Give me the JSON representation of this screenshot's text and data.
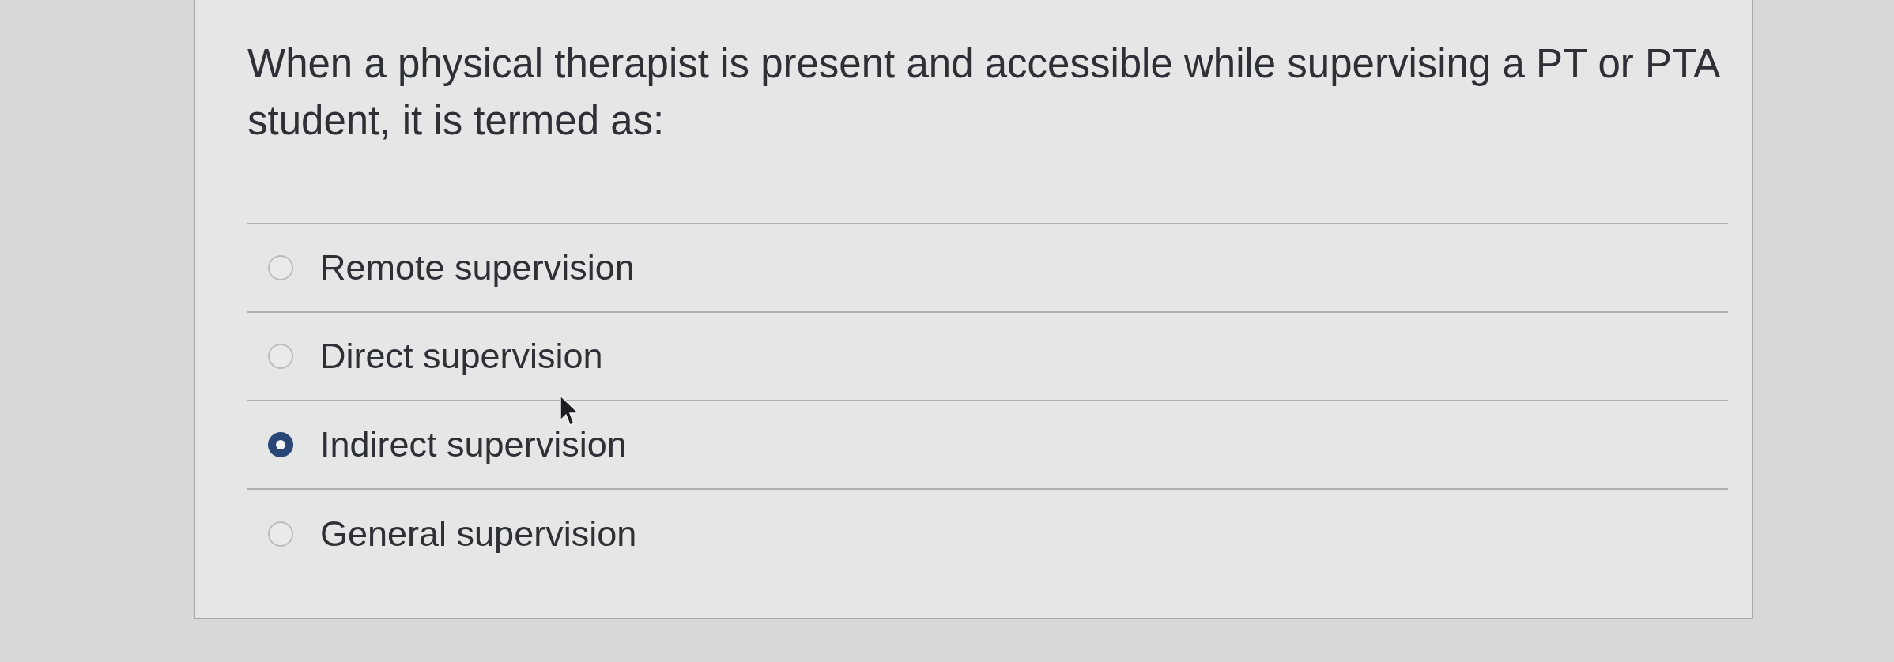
{
  "question": {
    "text": "When a physical therapist is present and accessible while supervising a PT or PTA student, it is termed as:"
  },
  "options": [
    {
      "label": "Remote supervision",
      "selected": false
    },
    {
      "label": "Direct supervision",
      "selected": false
    },
    {
      "label": "Indirect supervision",
      "selected": true
    },
    {
      "label": "General supervision",
      "selected": false
    }
  ]
}
